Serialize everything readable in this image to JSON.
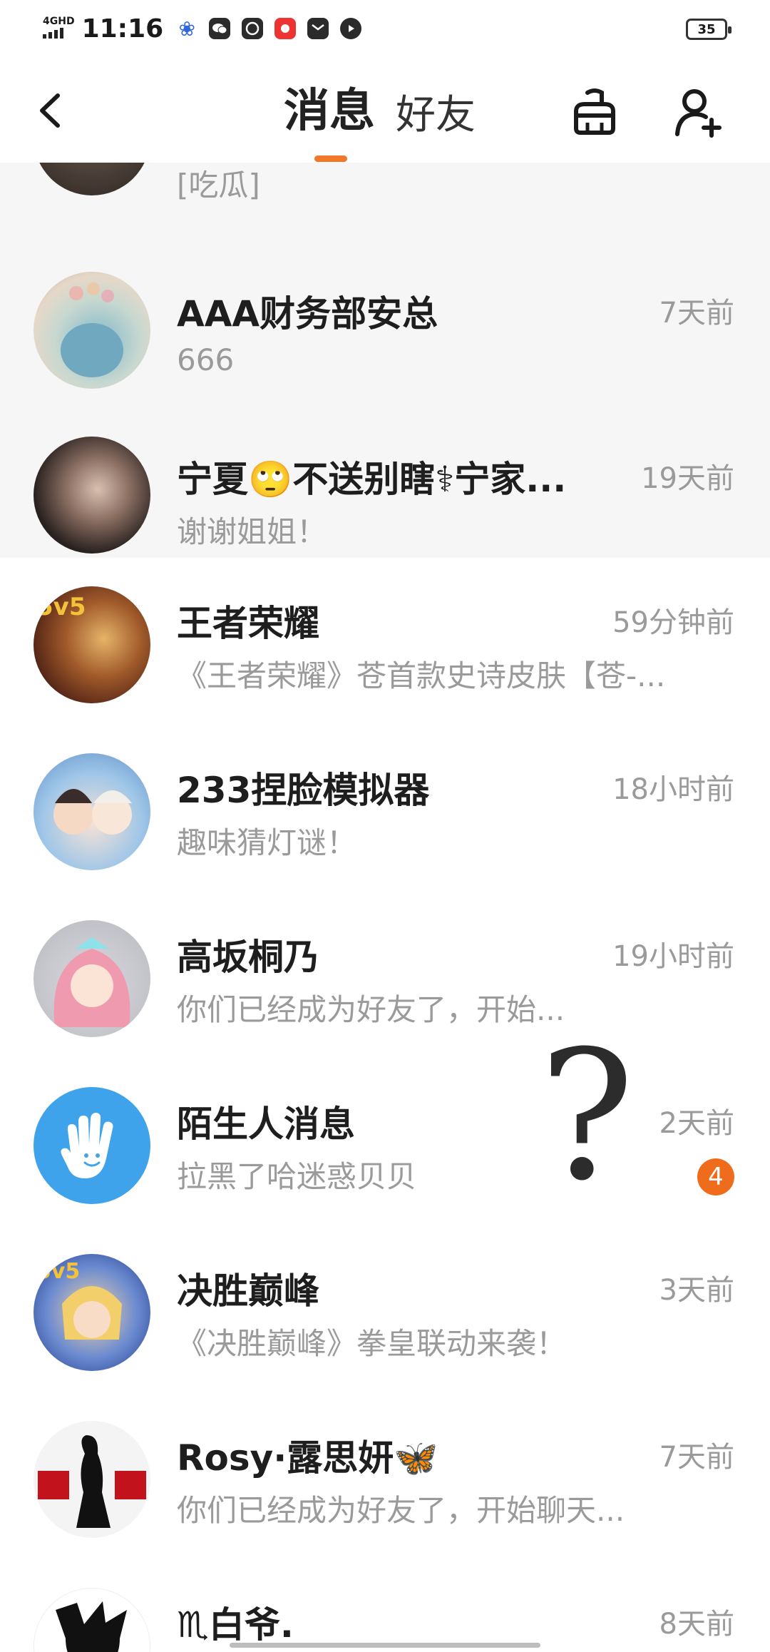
{
  "status": {
    "network_top": "4GHD",
    "network_bottom": "all",
    "time": "11:16",
    "battery": "35"
  },
  "header": {
    "tab_messages": "消息",
    "tab_friends": "好友"
  },
  "partial_row": {
    "preview": "[吃瓜]"
  },
  "conversations": [
    {
      "name": "AAA财务部安总",
      "preview": "666",
      "time": "7天前"
    },
    {
      "name": "宁夏🙄不送别瞎⚕宁家...",
      "preview": "谢谢姐姐！",
      "time": "19天前"
    },
    {
      "name": "王者荣耀",
      "preview": "《王者荣耀》苍首款史诗皮肤【苍-...",
      "time": "59分钟前"
    },
    {
      "name": "233捏脸模拟器",
      "preview": "趣味猜灯谜！",
      "time": "18小时前"
    },
    {
      "name": "高坂桐乃",
      "preview": "你们已经成为好友了，开始...",
      "time": "19小时前"
    },
    {
      "name": "陌生人消息",
      "preview": "拉黑了哈迷惑贝贝",
      "time": "2天前",
      "badge": "4"
    },
    {
      "name": "决胜巅峰",
      "preview": "《决胜巅峰》拳皇联动来袭！",
      "time": "3天前"
    },
    {
      "name": "Rosy·露思妍🦋",
      "preview": "你们已经成为好友了，开始聊天...",
      "time": "7天前"
    },
    {
      "name": "♏白爷.",
      "preview": "",
      "time": "8天前"
    }
  ],
  "overlay": {
    "question_mark": "?"
  },
  "colors": {
    "accent": "#f07828",
    "badge": "#ef6c1d",
    "pinned_bg": "#f6f6f6"
  }
}
